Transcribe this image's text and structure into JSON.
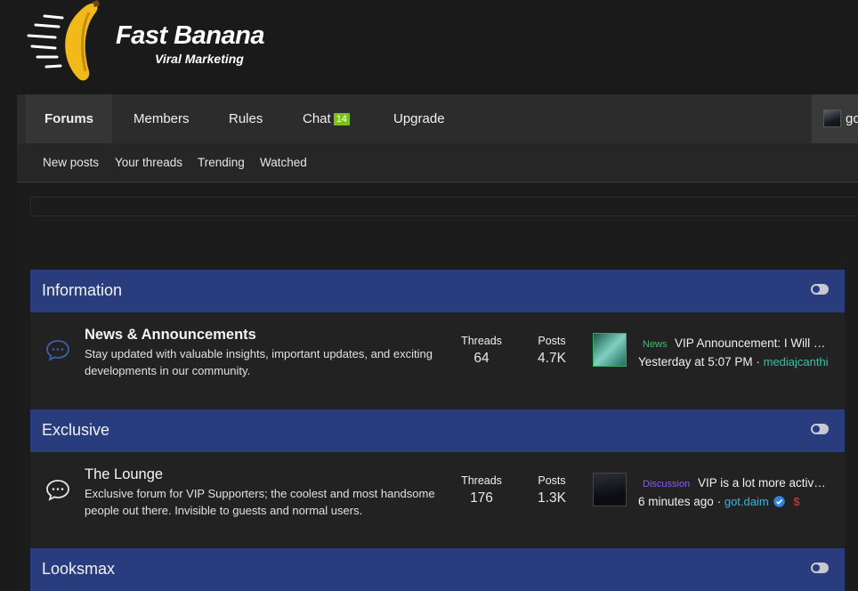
{
  "site": {
    "logo_title": "Fast Banana",
    "logo_subtitle": "Viral Marketing"
  },
  "nav": {
    "tabs": [
      {
        "label": "Forums"
      },
      {
        "label": "Members"
      },
      {
        "label": "Rules"
      },
      {
        "label": "Chat"
      },
      {
        "label": "Upgrade"
      }
    ],
    "chat_badge": "14",
    "user_name": "go"
  },
  "subnav": {
    "links": [
      "New posts",
      "Your threads",
      "Trending",
      "Watched"
    ]
  },
  "categories": [
    {
      "title": "Information",
      "forums": [
        {
          "title": "News & Announcements",
          "description": "Stay updated with valuable insights, important updates, and exciting developments in our community.",
          "threads_label": "Threads",
          "threads": "64",
          "posts_label": "Posts",
          "posts": "4.7K",
          "last_prefix": "News",
          "last_title": "VIP Announcement: I Will …",
          "last_time": "Yesterday at 5:07 PM",
          "last_user": "mediajcanthi"
        }
      ]
    },
    {
      "title": "Exclusive",
      "forums": [
        {
          "title": "The Lounge",
          "description": "Exclusive forum for VIP Supporters; the coolest and most handsome people out there. Invisible to guests and normal users.",
          "threads_label": "Threads",
          "threads": "176",
          "posts_label": "Posts",
          "posts": "1.3K",
          "last_prefix": "Discussion",
          "last_title": "VIP is a lot more activ…",
          "last_time": "6 minutes ago",
          "last_user": "got.daim"
        }
      ]
    },
    {
      "title": "Looksmax",
      "forums": []
    }
  ],
  "separator": "·",
  "colors": {
    "accent_green": "#7cc118",
    "category_bg": "#293d7e",
    "news_prefix": "#3fbf6a",
    "discussion_prefix": "#8a5cf0",
    "user_teal": "#2ec4a8",
    "user_blue": "#35b3e8"
  }
}
